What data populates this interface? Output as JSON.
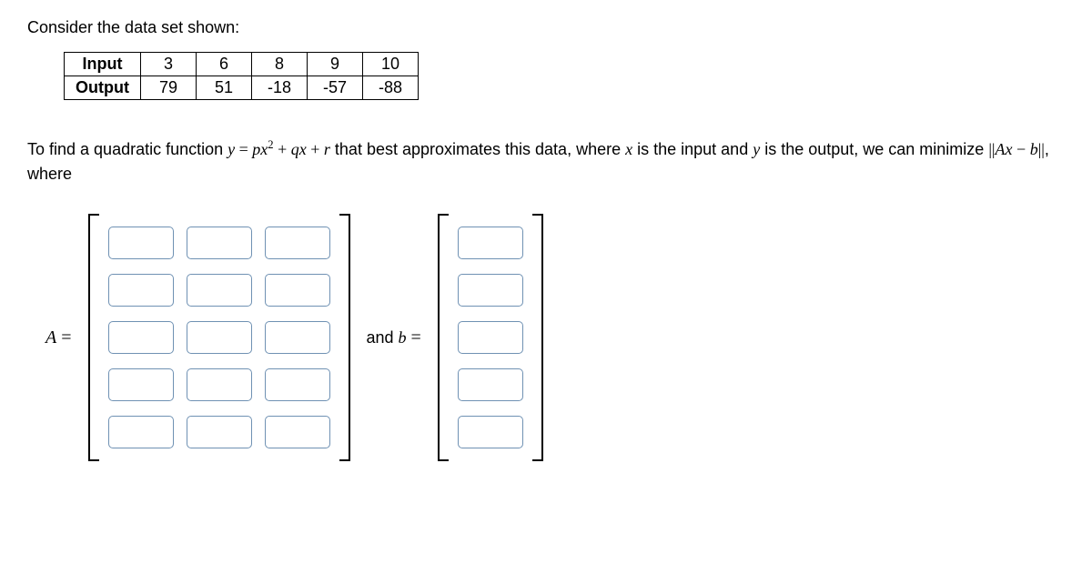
{
  "intro": "Consider the data set shown:",
  "table": {
    "row1_label": "Input",
    "row2_label": "Output",
    "inputs": [
      "3",
      "6",
      "8",
      "9",
      "10"
    ],
    "outputs": [
      "79",
      "51",
      "-18",
      "-57",
      "-88"
    ]
  },
  "explain": {
    "part1": "To find a quadratic function ",
    "eq_lhs": "y",
    "eq_eq": " = ",
    "eq_rhs_p": "p",
    "eq_rhs_x": "x",
    "eq_rhs_sq": "2",
    "eq_rhs_plus1": " + ",
    "eq_rhs_q": "q",
    "eq_rhs_x2": "x",
    "eq_rhs_plus2": " + ",
    "eq_rhs_r": "r",
    "part2": " that best approximates this data, where ",
    "xvar": "x",
    "part3": " is the input and ",
    "yvar": "y",
    "part4": " is the output, we can minimize ",
    "norm1": "||",
    "Avar": "A",
    "xvar2": "x",
    "minus": " − ",
    "bvar": "b",
    "norm2": "||",
    "part5": ", where"
  },
  "matrix": {
    "A_label": "A",
    "eq1": " =",
    "and": "and ",
    "b_label": "b",
    "eq2": " =",
    "A_rows": 5,
    "A_cols": 3,
    "b_rows": 5
  }
}
